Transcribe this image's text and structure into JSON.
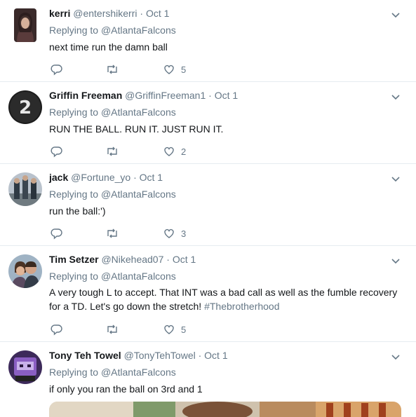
{
  "tweets": [
    {
      "name": "kerri",
      "handle": "@entershikerri",
      "date": "Oct 1",
      "replying_prefix": "Replying to ",
      "replying_to": "@AtlantaFalcons",
      "text": "next time run the damn ball",
      "likes": "5"
    },
    {
      "name": "Griffin Freeman",
      "handle": "@GriffinFreeman1",
      "date": "Oct 1",
      "replying_prefix": "Replying to ",
      "replying_to": "@AtlantaFalcons",
      "text": "RUN THE BALL. RUN IT. JUST RUN IT.",
      "likes": "2"
    },
    {
      "name": "jack",
      "handle": "@Fortune_yo",
      "date": "Oct 1",
      "replying_prefix": "Replying to ",
      "replying_to": "@AtlantaFalcons",
      "text": "run the ball:')",
      "likes": "3"
    },
    {
      "name": "Tim Setzer",
      "handle": "@Nikehead07",
      "date": "Oct 1",
      "replying_prefix": "Replying to ",
      "replying_to": "@AtlantaFalcons",
      "text_line1": "A very tough L to accept. That INT was a bad call as well as the fumble recovery",
      "text_line2": "for a TD.  Let's go down the stretch!",
      "hashtag": "#Thebrotherhood",
      "likes": "5"
    },
    {
      "name": "Tony Teh Towel",
      "handle": "@TonyTehTowel",
      "date": "Oct 1",
      "replying_prefix": "Replying to ",
      "replying_to": "@AtlantaFalcons",
      "text": "if only you ran the ball on 3rd and 1"
    }
  ],
  "dot": "·",
  "icons": {
    "reply": "reply-icon",
    "retweet": "retweet-icon",
    "like": "heart-icon",
    "menu": "chevron-down-icon"
  },
  "colors": {
    "text": "#14171a",
    "muted": "#657786",
    "divider": "#e6ecf0"
  }
}
